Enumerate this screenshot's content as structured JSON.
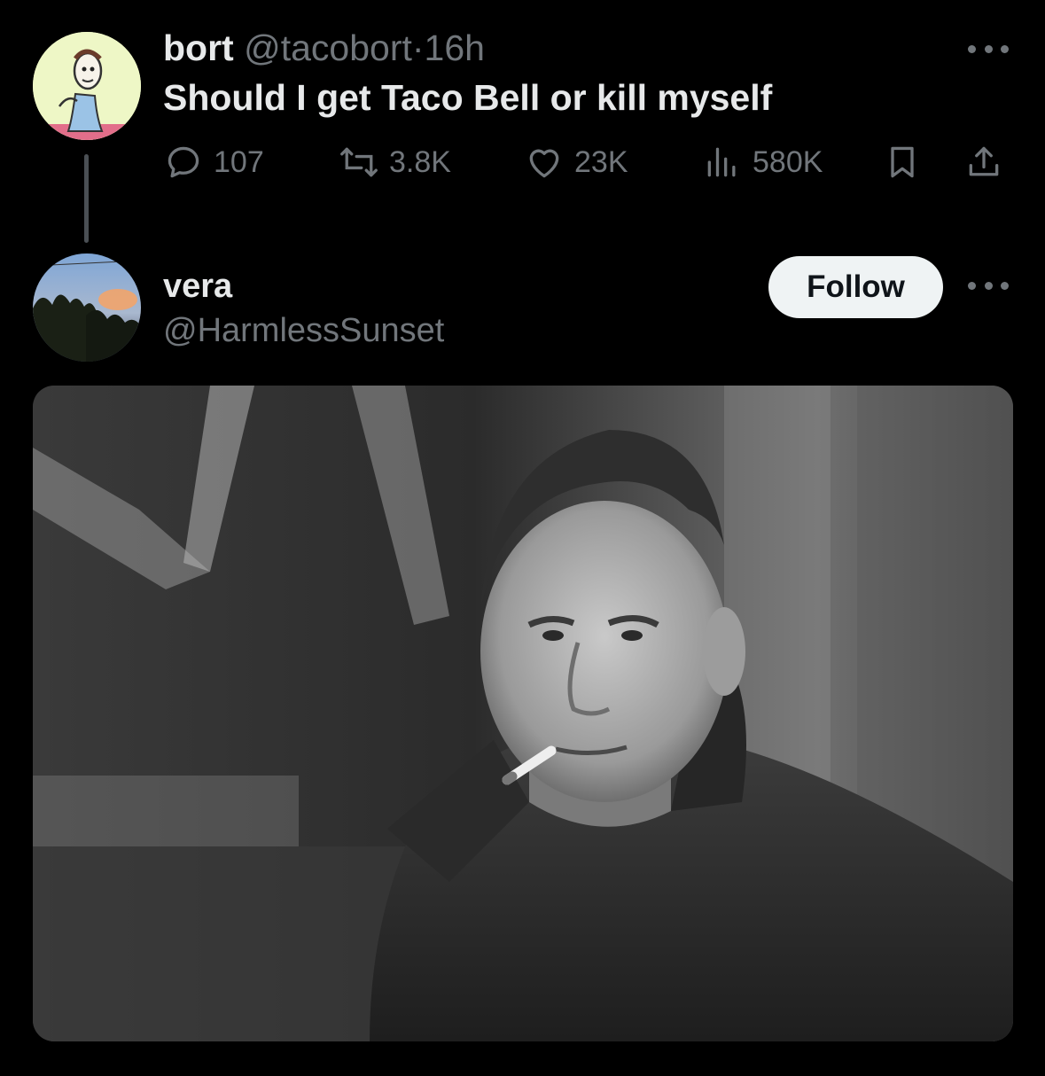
{
  "post1": {
    "display_name": "bort",
    "handle": "@tacobort",
    "separator": "·",
    "time": "16h",
    "text": "Should I get Taco Bell or kill myself",
    "actions": {
      "replies": "107",
      "reposts": "3.8K",
      "likes": "23K",
      "views": "580K"
    },
    "avatar_icon": "cartoon-character-icon"
  },
  "post2": {
    "display_name": "vera",
    "handle": "@HarmlessSunset",
    "follow_label": "Follow",
    "avatar_icon": "sunset-trees-icon",
    "media_description_icon": "photo-man-smoking-icon"
  },
  "colors": {
    "background": "#000000",
    "text_primary": "#e7e9ea",
    "text_secondary": "#71767b",
    "follow_button_bg": "#eff3f4",
    "follow_button_text": "#0f1419"
  }
}
